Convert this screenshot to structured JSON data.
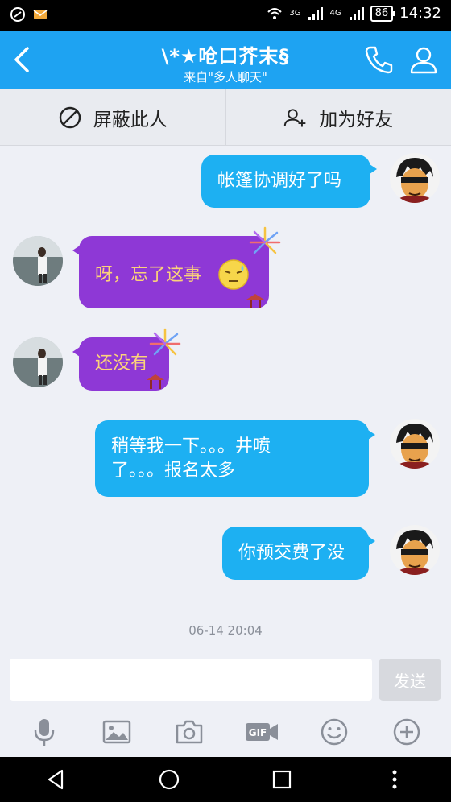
{
  "status_bar": {
    "time": "14:32",
    "battery": "86",
    "net_3g": "3G",
    "net_4g": "4G"
  },
  "header": {
    "title": "\\*★呛口芥末§",
    "subtitle": "来自\"多人聊天\""
  },
  "actions": {
    "block_label": "屏蔽此人",
    "add_friend_label": "加为好友"
  },
  "messages": [
    {
      "sender": "me",
      "text": "帐篷协调好了吗"
    },
    {
      "sender": "them",
      "text": "呀，忘了这事",
      "emoji": "sweat-face-icon"
    },
    {
      "sender": "them",
      "text": "还没有"
    },
    {
      "sender": "me",
      "lines": [
        "稍等我一下。。。井喷",
        "了。。。报名太多"
      ]
    },
    {
      "sender": "me",
      "text": "你预交费了没"
    }
  ],
  "timestamp": "06-14 20:04",
  "input": {
    "value": "",
    "send_label": "发送"
  },
  "colors": {
    "header": "#1ea3f2",
    "my_bubble": "#1db0f2",
    "their_bubble": "#8e38d6",
    "their_text": "#fbd27a"
  }
}
